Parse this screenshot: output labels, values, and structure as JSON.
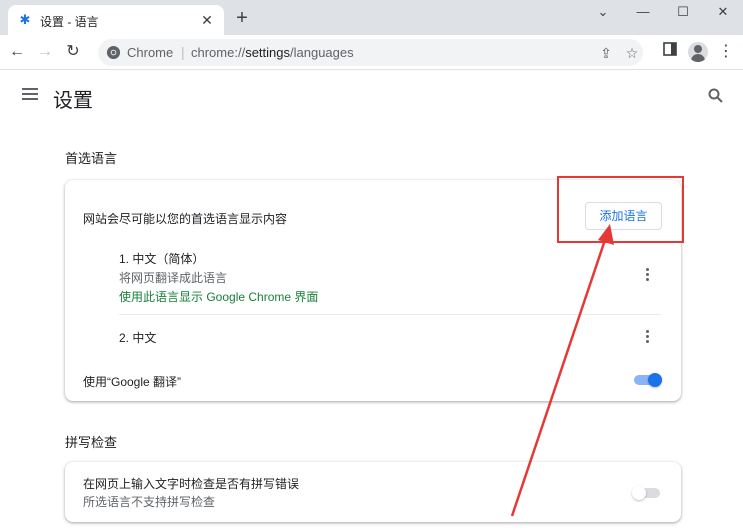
{
  "browser": {
    "tab_title": "设置 - 语言",
    "tab_icon": "gear-icon",
    "omnibox_site": "Chrome",
    "omnibox_url_prefix": "chrome://",
    "omnibox_url_bold": "settings",
    "omnibox_url_suffix": "/languages"
  },
  "header": {
    "title": "设置"
  },
  "preferred_languages": {
    "section_title": "首选语言",
    "description": "网站会尽可能以您的首选语言显示内容",
    "add_button": "添加语言",
    "languages": [
      {
        "name": "1. 中文（简体）",
        "subtitle": "将网页翻译成此语言",
        "ui_note": "使用此语言显示 Google Chrome 界面"
      },
      {
        "name": "2. 中文"
      }
    ],
    "translate_label": "使用“Google 翻译”",
    "translate_enabled": true
  },
  "spell_check": {
    "section_title": "拼写检查",
    "label": "在网页上输入文字时检查是否有拼写错误",
    "sublabel": "所选语言不支持拼写检查",
    "enabled": false
  },
  "colors": {
    "accent": "#1a73e8",
    "green": "#188038",
    "annotation": "#e53935"
  }
}
